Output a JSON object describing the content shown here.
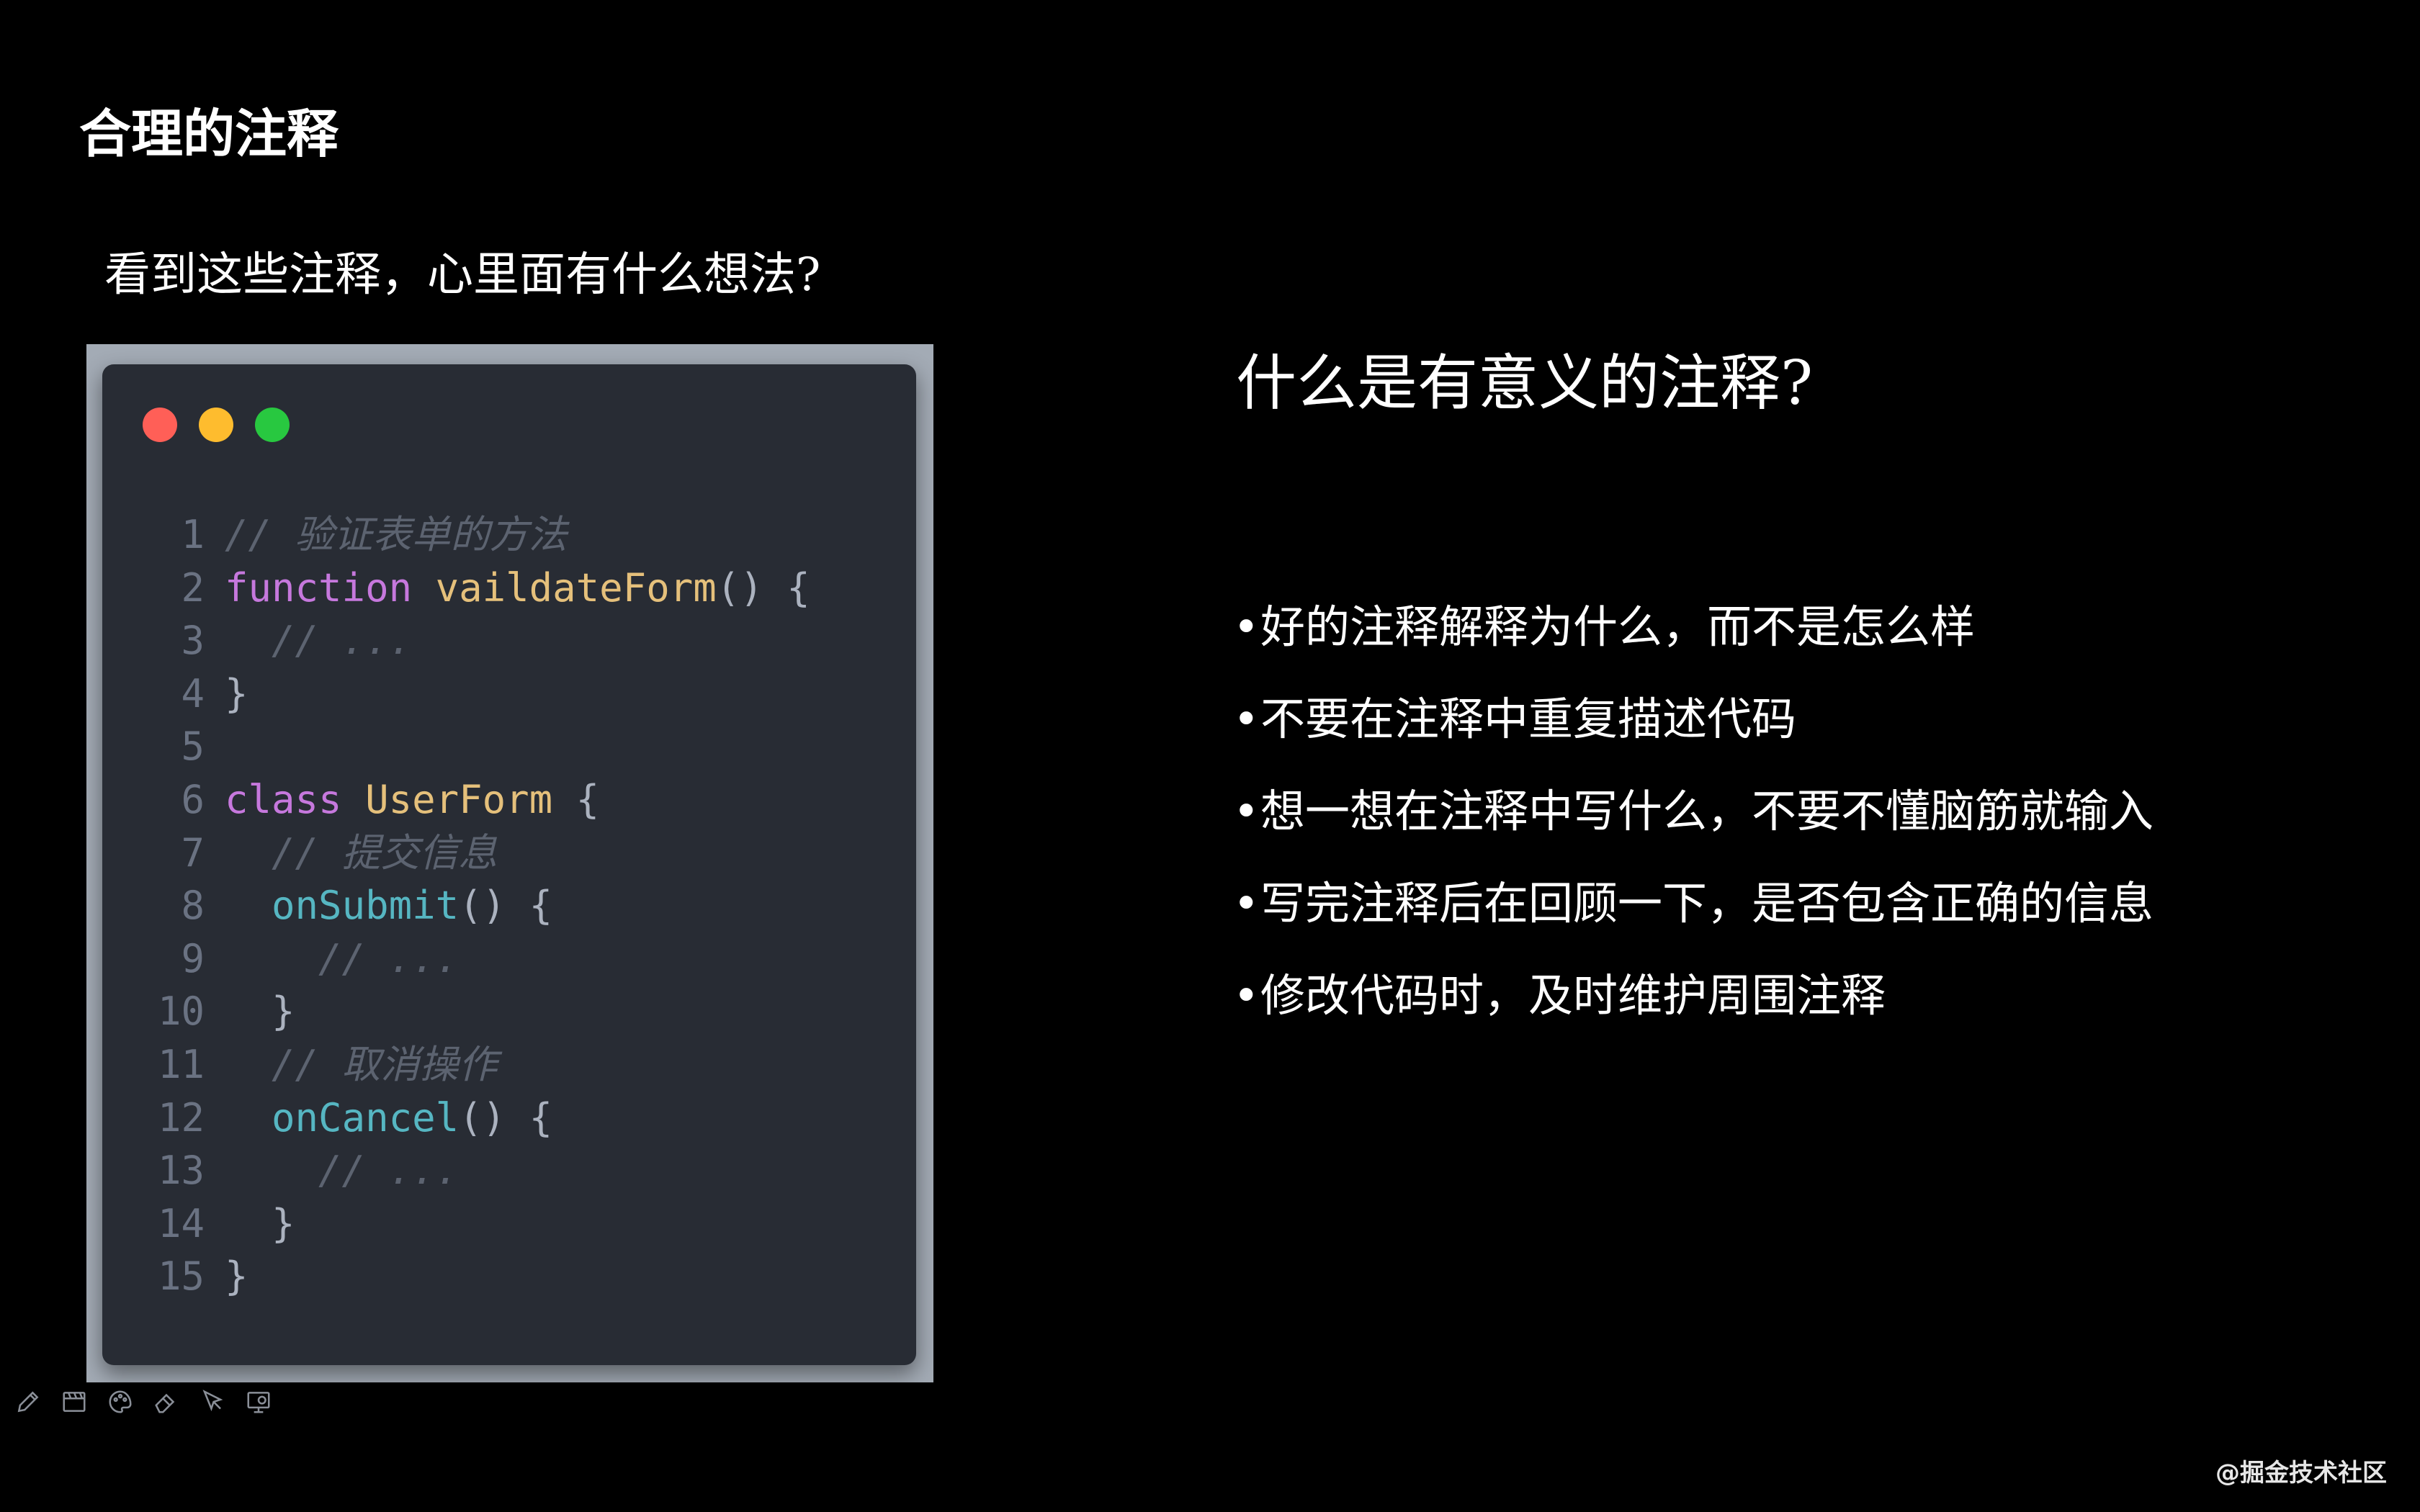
{
  "slide": {
    "title": "合理的注释",
    "question": "看到这些注释，心里面有什么想法?"
  },
  "code_window": {
    "traffic_lights": [
      {
        "name": "close",
        "color": "#ff5f57"
      },
      {
        "name": "minimize",
        "color": "#febc2e"
      },
      {
        "name": "maximize",
        "color": "#28c840"
      }
    ],
    "lines": [
      {
        "no": "1",
        "tokens": [
          {
            "t": "// 验证表单的方法",
            "c": "comment"
          }
        ]
      },
      {
        "no": "2",
        "tokens": [
          {
            "t": "function ",
            "c": "keyword"
          },
          {
            "t": "vaildateForm",
            "c": "class"
          },
          {
            "t": "() {",
            "c": "punct"
          }
        ]
      },
      {
        "no": "3",
        "tokens": [
          {
            "t": "  // ...",
            "c": "comment"
          }
        ]
      },
      {
        "no": "4",
        "tokens": [
          {
            "t": "}",
            "c": "punct"
          }
        ]
      },
      {
        "no": "5",
        "tokens": []
      },
      {
        "no": "6",
        "tokens": [
          {
            "t": "class ",
            "c": "keyword"
          },
          {
            "t": "UserForm",
            "c": "class"
          },
          {
            "t": " {",
            "c": "punct"
          }
        ]
      },
      {
        "no": "7",
        "tokens": [
          {
            "t": "  // 提交信息",
            "c": "comment"
          }
        ]
      },
      {
        "no": "8",
        "tokens": [
          {
            "t": "  ",
            "c": "plain"
          },
          {
            "t": "onSubmit",
            "c": "fn"
          },
          {
            "t": "() {",
            "c": "punct"
          }
        ]
      },
      {
        "no": "9",
        "tokens": [
          {
            "t": "    // ...",
            "c": "comment"
          }
        ]
      },
      {
        "no": "10",
        "tokens": [
          {
            "t": "  }",
            "c": "punct"
          }
        ]
      },
      {
        "no": "11",
        "tokens": [
          {
            "t": "  // 取消操作",
            "c": "comment"
          }
        ]
      },
      {
        "no": "12",
        "tokens": [
          {
            "t": "  ",
            "c": "plain"
          },
          {
            "t": "onCancel",
            "c": "fn"
          },
          {
            "t": "() {",
            "c": "punct"
          }
        ]
      },
      {
        "no": "13",
        "tokens": [
          {
            "t": "    // ...",
            "c": "comment"
          }
        ]
      },
      {
        "no": "14",
        "tokens": [
          {
            "t": "  }",
            "c": "punct"
          }
        ]
      },
      {
        "no": "15",
        "tokens": [
          {
            "t": "}",
            "c": "punct"
          }
        ]
      }
    ]
  },
  "right_panel": {
    "heading": "什么是有意义的注释?",
    "bullet_symbol": "•",
    "bullets": [
      "好的注释解释为什么，而不是怎么样",
      "不要在注释中重复描述代码",
      "想一想在注释中写什么，不要不懂脑筋就输入",
      "写完注释后在回顾一下，是否包含正确的信息",
      "修改代码时，及时维护周围注释"
    ]
  },
  "toolbar": {
    "tools": [
      "pencil-icon",
      "clapperboard-icon",
      "palette-icon",
      "eraser-icon",
      "pointer-icon",
      "screen-icon"
    ]
  },
  "watermark": "@掘金技术社区"
}
